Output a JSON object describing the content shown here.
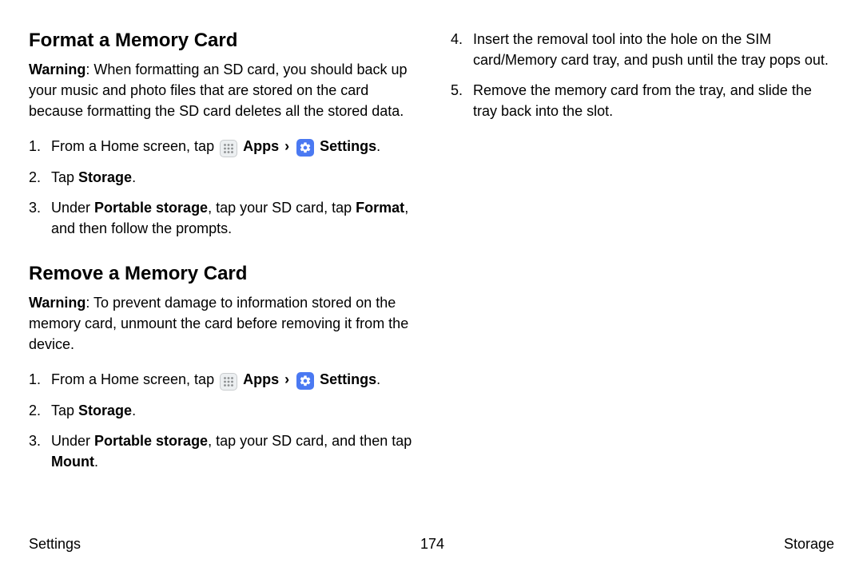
{
  "left": {
    "section1": {
      "title": "Format a Memory Card",
      "warning_label": "Warning",
      "warning_text": ": When formatting an SD card, you should back up your music and photo files that are stored on the card because formatting the SD card deletes all the stored data.",
      "step1_pre": "From a Home screen, tap ",
      "apps_label": " Apps ",
      "chevron": "›",
      "settings_label": " Settings",
      "step1_post": ".",
      "step2_pre": "Tap ",
      "step2_bold": "Storage",
      "step2_post": ".",
      "step3_pre": "Under ",
      "step3_b1": "Portable storage",
      "step3_mid": ", tap your SD card, tap ",
      "step3_b2": "Format",
      "step3_post": ", and then follow the prompts."
    },
    "section2": {
      "title": "Remove a Memory Card",
      "warning_label": "Warning",
      "warning_text": ": To prevent damage to information stored on the memory card, unmount the card before removing it from the device.",
      "step1_pre": "From a Home screen, tap ",
      "apps_label": " Apps ",
      "chevron": "›",
      "settings_label": " Settings",
      "step1_post": ".",
      "step2_pre": "Tap ",
      "step2_bold": "Storage",
      "step2_post": ".",
      "step3_pre": "Under ",
      "step3_b1": "Portable storage",
      "step3_mid": ", tap your SD card, and then tap ",
      "step3_b2": "Mount",
      "step3_post": "."
    }
  },
  "right": {
    "step4": "Insert the removal tool into the hole on the SIM card/Memory card tray, and push until the tray pops out.",
    "step5": "Remove the memory card from the tray, and slide the tray back into the slot."
  },
  "nums": {
    "n1": "1.",
    "n2": "2.",
    "n3": "3.",
    "n4": "4.",
    "n5": "5."
  },
  "footer": {
    "left": "Settings",
    "center": "174",
    "right": "Storage"
  }
}
